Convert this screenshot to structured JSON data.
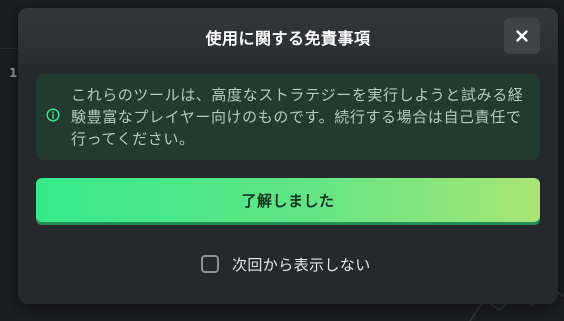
{
  "background": {
    "partial_number": "1"
  },
  "modal": {
    "title": "使用に関する免責事項",
    "close_icon": "close-icon",
    "notice": {
      "icon": "info-icon",
      "text": "これらのツールは、高度なストラテジーを実行しようと試みる経験豊富なプレイヤー向けのものです。続行する場合は自己責任で行ってください。"
    },
    "acknowledge_label": "了解しました",
    "dont_show_label": "次回から表示しない",
    "dont_show_checked": false
  },
  "colors": {
    "accent_start": "#34ea8a",
    "accent_end": "#a9e574",
    "notice_bg": "#223b31",
    "modal_bg": "#26282b"
  }
}
